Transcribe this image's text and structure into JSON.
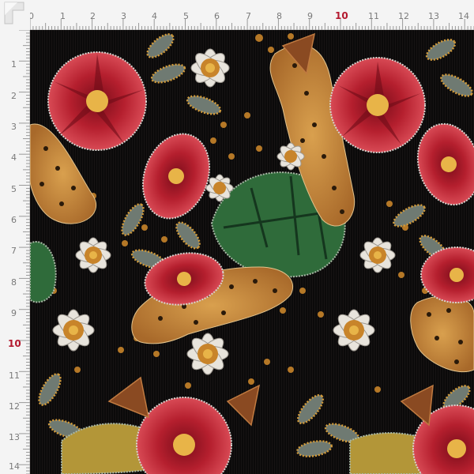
{
  "ruler": {
    "unit": "cm",
    "top_labels": [
      "0",
      "1",
      "2",
      "3",
      "4",
      "5",
      "6",
      "7",
      "8",
      "9",
      "10",
      "11",
      "12",
      "13",
      "14"
    ],
    "left_labels": [
      "1",
      "2",
      "3",
      "4",
      "5",
      "6",
      "7",
      "8",
      "9",
      "10",
      "11",
      "12",
      "13",
      "14"
    ],
    "emphasis_label": "10"
  },
  "fabric": {
    "pattern": "embroidered jungle print",
    "motifs": [
      "hibiscus-flower",
      "daisy-flower",
      "leopard",
      "monstera-leaf",
      "gold-bead-leaf"
    ],
    "colors": {
      "background": "#0b0a0a",
      "hibiscus": "#b51f2e",
      "hibiscus_dark": "#6e0c18",
      "daisy": "#e8e4dc",
      "daisy_center": "#c8842a",
      "leopard": "#c88a3a",
      "leopard_spot": "#2a1a0a",
      "monstera": "#2f6b3a",
      "gold": "#d19a3a",
      "grey_leaf": "#6f7a72",
      "accent": "#b3192e"
    }
  }
}
